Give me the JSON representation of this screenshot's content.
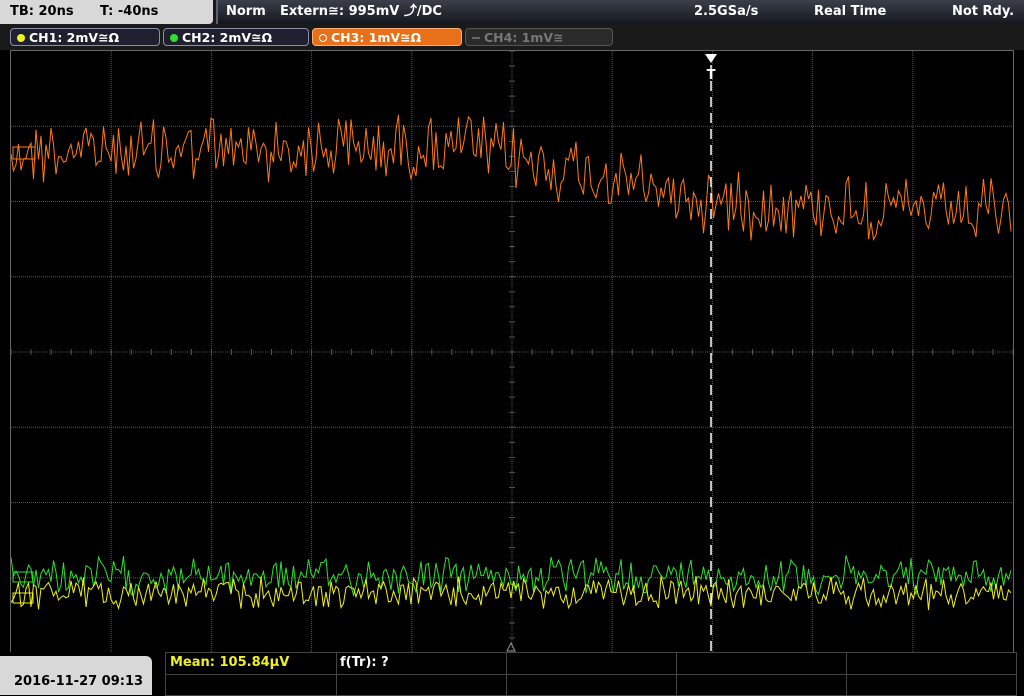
{
  "status": {
    "timebase": "TB: 20ns",
    "trigger_time": "T: -40ns",
    "mode": "Norm",
    "trigger_source": "Extern≅: 995mV ⤴/DC",
    "sample_rate": "2.5GSa/s",
    "acq_mode": "Real Time",
    "state": "Not Rdy."
  },
  "channels": [
    {
      "label": "CH1: 2mV≅Ω",
      "color": "#f0f020",
      "active": true
    },
    {
      "label": "CH2: 2mV≅Ω",
      "color": "#30e030",
      "active": true
    },
    {
      "label": "CH3: 1mV≅Ω",
      "color": "#ff7a1a",
      "active": true,
      "selected": true
    },
    {
      "label": "CH4: 1mV≅",
      "color": "#666666",
      "active": false
    }
  ],
  "trigger_marker": "T",
  "measurements": {
    "mean": "Mean: 105.84µV",
    "ftr": "f(Tr): ?"
  },
  "datetime": "2016-11-27 09:13",
  "colors": {
    "ch1": "#f0f020",
    "ch2": "#30e030",
    "ch3": "#ff7a1a",
    "grid": "#555555"
  }
}
